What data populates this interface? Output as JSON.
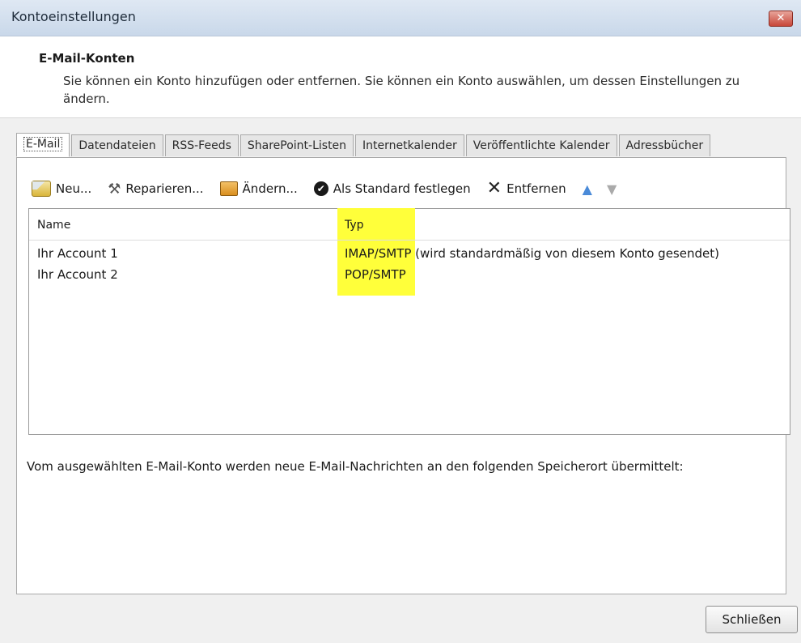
{
  "window": {
    "title": "Kontoeinstellungen"
  },
  "header": {
    "title": "E-Mail-Konten",
    "description": "Sie können ein Konto hinzufügen oder entfernen. Sie können ein Konto auswählen, um dessen Einstellungen zu ändern."
  },
  "tabs": [
    {
      "label": "E-Mail",
      "active": true
    },
    {
      "label": "Datendateien"
    },
    {
      "label": "RSS-Feeds"
    },
    {
      "label": "SharePoint-Listen"
    },
    {
      "label": "Internetkalender"
    },
    {
      "label": "Veröffentlichte Kalender"
    },
    {
      "label": "Adressbücher"
    }
  ],
  "toolbar": {
    "new_label": "Neu...",
    "repair_label": "Reparieren...",
    "change_label": "Ändern...",
    "default_label": "Als Standard festlegen",
    "remove_label": "Entfernen"
  },
  "list": {
    "columns": [
      "Name",
      "Typ"
    ],
    "rows": [
      {
        "name": "Ihr Account 1",
        "type": "IMAP/SMTP",
        "note": " (wird standardmäßig von diesem Konto gesendet)"
      },
      {
        "name": "Ihr Account 2",
        "type": "POP/SMTP",
        "note": ""
      }
    ]
  },
  "info_text": "Vom ausgewählten E-Mail-Konto werden neue E-Mail-Nachrichten an den folgenden Speicherort übermittelt:",
  "footer": {
    "close_label": "Schließen"
  },
  "colors": {
    "highlight": "#ffff3a"
  }
}
